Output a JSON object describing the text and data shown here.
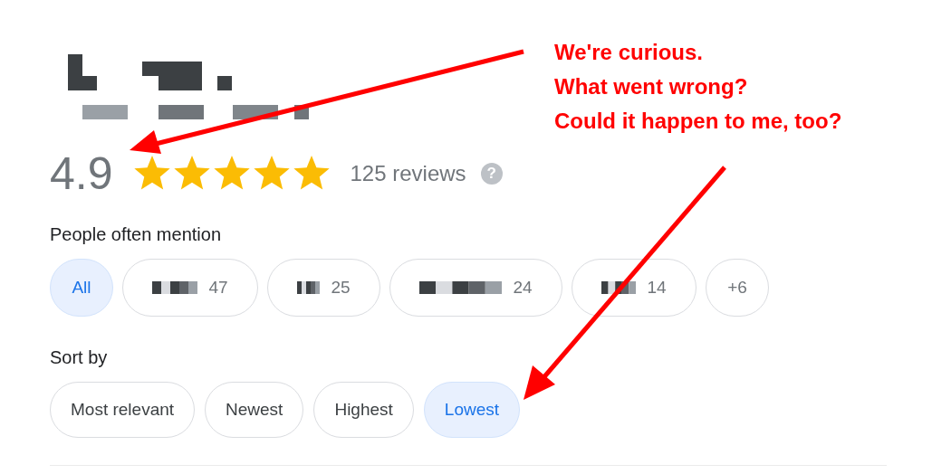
{
  "place": {
    "kind": "redacted"
  },
  "rating": {
    "score": "4.9",
    "stars": 5,
    "reviews": "125 reviews",
    "help": "?"
  },
  "mentions": {
    "title": "People often mention",
    "chips": [
      {
        "kind": "text",
        "label": "All",
        "selected": true
      },
      {
        "kind": "redacted",
        "count": "47",
        "selected": false
      },
      {
        "kind": "redacted",
        "count": "25",
        "selected": false
      },
      {
        "kind": "redacted",
        "count": "24",
        "selected": false
      },
      {
        "kind": "redacted",
        "count": "14",
        "selected": false
      },
      {
        "kind": "text",
        "label": "+6",
        "selected": false
      }
    ]
  },
  "sort": {
    "title": "Sort by",
    "options": [
      {
        "label": "Most relevant",
        "selected": false
      },
      {
        "label": "Newest",
        "selected": false
      },
      {
        "label": "Highest",
        "selected": false
      },
      {
        "label": "Lowest",
        "selected": true
      }
    ]
  },
  "annotation": {
    "lines": [
      "We're curious.",
      "What went wrong?",
      "Could it happen to me, too?"
    ]
  }
}
